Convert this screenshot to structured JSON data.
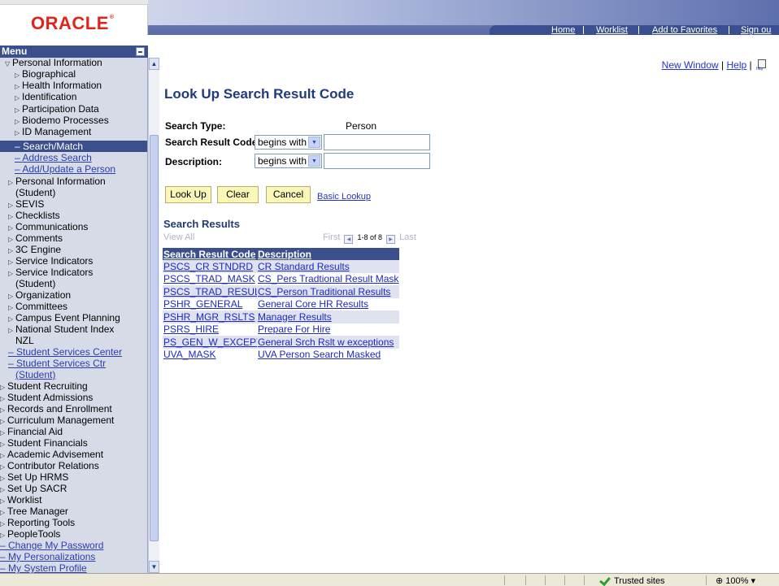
{
  "logo": {
    "text": "ORACLE",
    "mark": "®"
  },
  "nav": [
    {
      "label": "Home"
    },
    {
      "label": "Worklist"
    },
    {
      "label": "Add to Favorites"
    },
    {
      "label": "Sign ou"
    }
  ],
  "menu": {
    "title": "Menu",
    "items": [
      {
        "label": "Personal Information",
        "type": "open"
      },
      {
        "label": "Biographical",
        "type": "closed"
      },
      {
        "label": "Health Information",
        "type": "closed"
      },
      {
        "label": "Identification",
        "type": "closed"
      },
      {
        "label": "Participation Data",
        "type": "closed"
      },
      {
        "label": "Biodemo Processes",
        "type": "closed"
      },
      {
        "label": "ID Management",
        "type": "closed"
      },
      {
        "label": "Search/Match",
        "type": "selected"
      },
      {
        "label": "Address Search",
        "type": "link"
      },
      {
        "label": "Add/Update a Person",
        "type": "link"
      },
      {
        "label": "Personal Information",
        "type": "closed"
      },
      {
        "label": "(Student)",
        "type": "cont"
      },
      {
        "label": "SEVIS",
        "type": "closed"
      },
      {
        "label": "Checklists",
        "type": "closed"
      },
      {
        "label": "Communications",
        "type": "closed"
      },
      {
        "label": "Comments",
        "type": "closed"
      },
      {
        "label": "3C Engine",
        "type": "closed"
      },
      {
        "label": "Service Indicators",
        "type": "closed"
      },
      {
        "label": "Service Indicators",
        "type": "closed"
      },
      {
        "label": "(Student)",
        "type": "cont"
      },
      {
        "label": "Organization",
        "type": "closed"
      },
      {
        "label": "Committees",
        "type": "closed"
      },
      {
        "label": "Campus Event Planning",
        "type": "closed"
      },
      {
        "label": "National Student Index",
        "type": "closed"
      },
      {
        "label": "NZL",
        "type": "cont"
      },
      {
        "label": "Student Services Center",
        "type": "link"
      },
      {
        "label": "Student Services Ctr",
        "type": "link"
      },
      {
        "label": "(Student)",
        "type": "linkcont"
      },
      {
        "label": "Student Recruiting",
        "type": "top"
      },
      {
        "label": "Student Admissions",
        "type": "top"
      },
      {
        "label": "Records and Enrollment",
        "type": "top"
      },
      {
        "label": "Curriculum Management",
        "type": "top"
      },
      {
        "label": "Financial Aid",
        "type": "top"
      },
      {
        "label": "Student Financials",
        "type": "top"
      },
      {
        "label": "Academic Advisement",
        "type": "top"
      },
      {
        "label": "Contributor Relations",
        "type": "top"
      },
      {
        "label": "Set Up HRMS",
        "type": "top"
      },
      {
        "label": "Set Up SACR",
        "type": "top"
      },
      {
        "label": "Worklist",
        "type": "top"
      },
      {
        "label": "Tree Manager",
        "type": "top"
      },
      {
        "label": "Reporting Tools",
        "type": "top"
      },
      {
        "label": "PeopleTools",
        "type": "top"
      },
      {
        "label": "Change My Password",
        "type": "toplink"
      },
      {
        "label": "My Personalizations",
        "type": "toplink"
      },
      {
        "label": "My System Profile",
        "type": "toplink"
      }
    ]
  },
  "header_links": {
    "new_window": "New Window",
    "help": "Help",
    "separator": "|"
  },
  "page": {
    "title": "Look Up Search Result Code",
    "search_type_label": "Search Type:",
    "search_type_value": "Person",
    "code_label": "Search Result Code:",
    "code_operator": "begins with",
    "code_value": "",
    "desc_label": "Description:",
    "desc_operator": "begins with",
    "desc_value": ""
  },
  "buttons": {
    "lookup": "Look Up",
    "clear": "Clear",
    "cancel": "Cancel",
    "basic_lookup": "Basic Lookup"
  },
  "results": {
    "title": "Search Results",
    "view_all": "View All",
    "first": "First",
    "range": "1-8 of 8",
    "last": "Last",
    "columns": [
      "Search Result Code",
      "Description"
    ],
    "rows": [
      [
        "PSCS_CR STNDRD",
        "CR Standard Results"
      ],
      [
        "PSCS_TRAD_MASK",
        "CS_Pers Tradtional Result Mask"
      ],
      [
        "PSCS_TRAD_RESUL",
        "CS_Person Traditional Results"
      ],
      [
        "PSHR_GENERAL",
        "General Core HR Results"
      ],
      [
        "PSHR_MGR_RSLTS",
        "Manager Results"
      ],
      [
        "PSRS_HIRE",
        "Prepare For Hire"
      ],
      [
        "PS_GEN_W_EXCEPT",
        "General Srch Rslt w exceptions"
      ],
      [
        "UVA_MASK",
        "UVA Person Search Masked"
      ]
    ]
  },
  "statusbar": {
    "zone": "Trusted sites",
    "zoom": "100%"
  }
}
